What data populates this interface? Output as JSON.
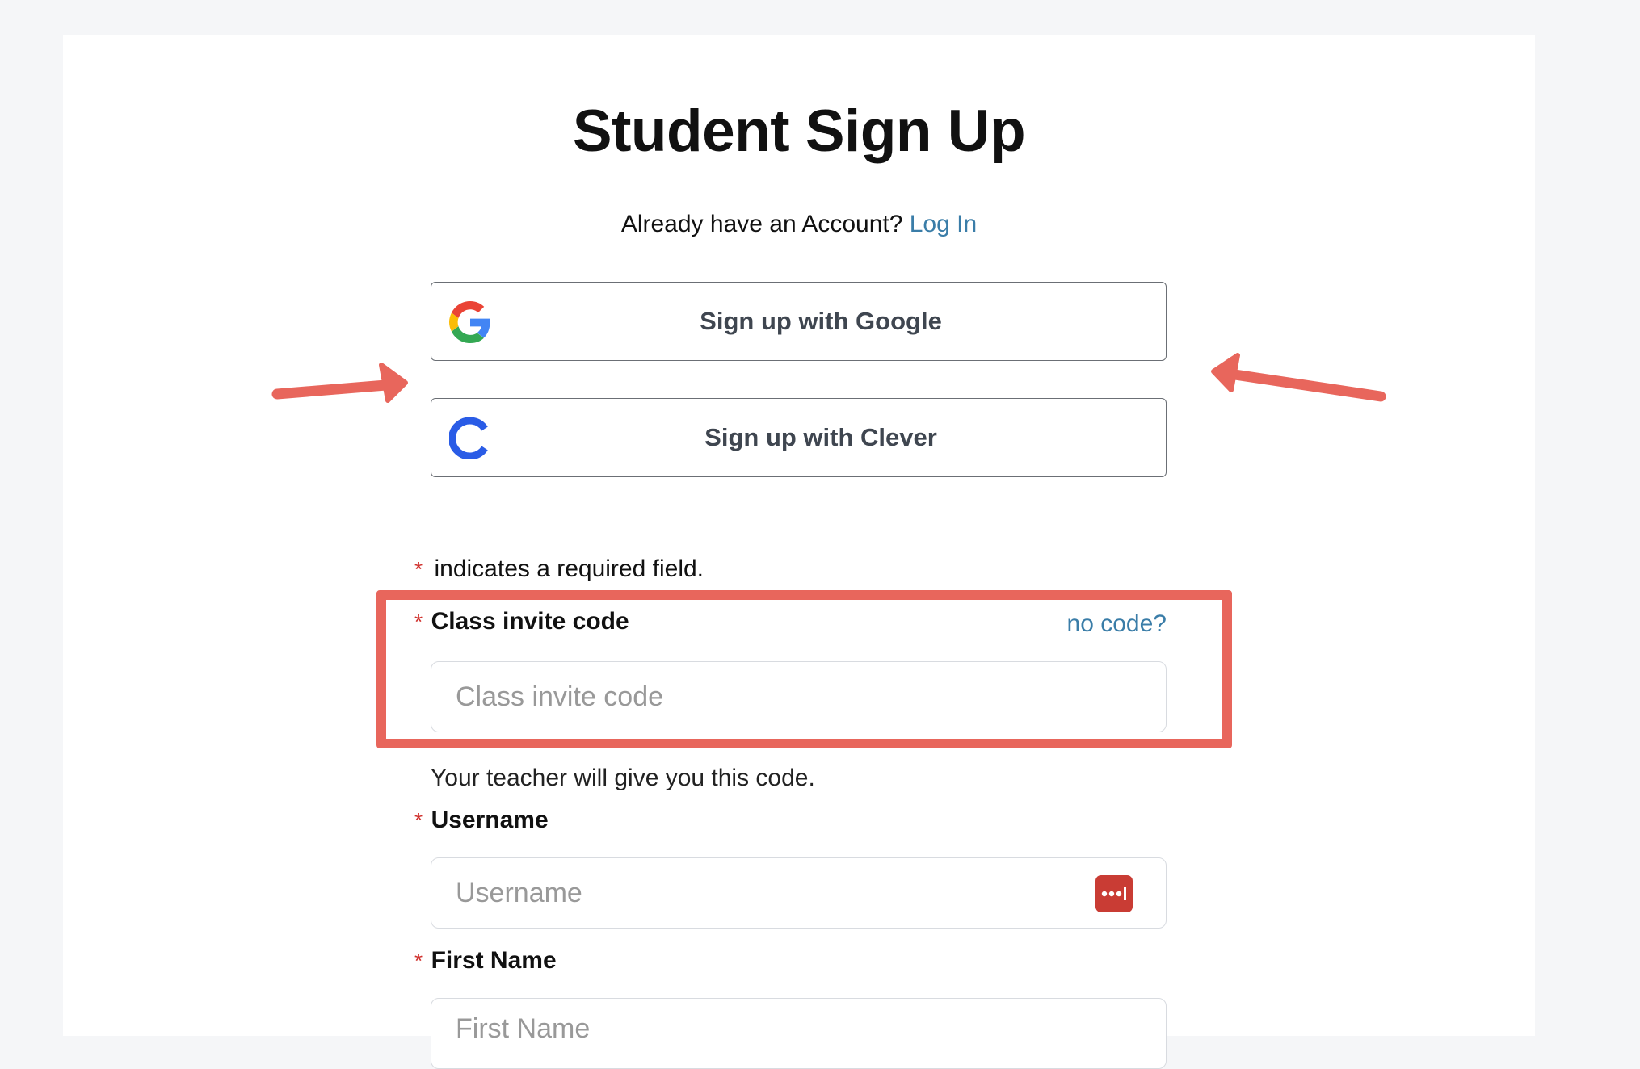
{
  "page": {
    "title": "Student Sign Up",
    "already_text": "Already have an Account?",
    "login_link": "Log In"
  },
  "sso": {
    "google_label": "Sign up with Google",
    "clever_label": "Sign up with Clever",
    "google_icon": "google-g-icon",
    "clever_icon": "clever-c-icon"
  },
  "form": {
    "required_marker": "*",
    "required_note": "indicates a required field.",
    "class_code": {
      "label": "Class invite code",
      "placeholder": "Class invite code",
      "no_code_link": "no code?",
      "helper": "Your teacher will give you this code."
    },
    "username": {
      "label": "Username",
      "placeholder": "Username",
      "password_manager_icon": "password-manager-icon"
    },
    "first_name": {
      "label": "First Name",
      "placeholder": "First Name"
    }
  },
  "annotations": {
    "highlight_color": "#e8665c",
    "arrow_color": "#e8665c"
  },
  "colors": {
    "link": "#3a7da8",
    "required": "#d0312d",
    "clever_blue": "#2a5ce6"
  }
}
